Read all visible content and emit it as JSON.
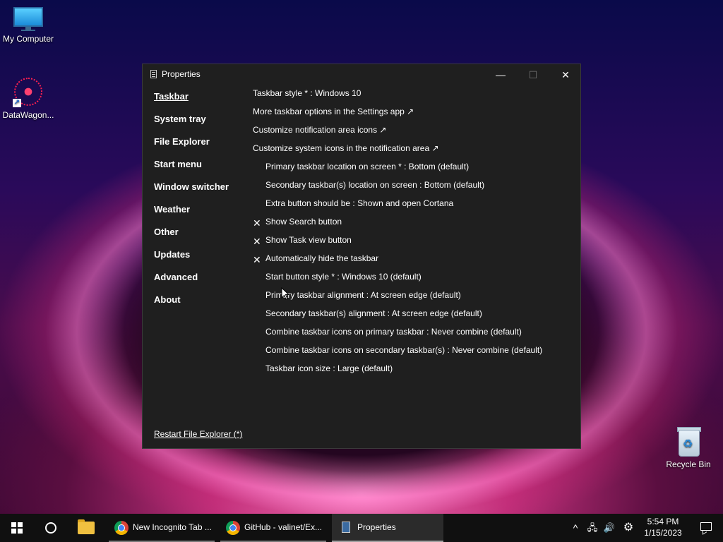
{
  "desktop": {
    "icons": [
      {
        "label": "My Computer"
      },
      {
        "label": "DataWagon..."
      },
      {
        "label": "Recycle Bin"
      }
    ]
  },
  "window": {
    "title": "Properties",
    "minimize_glyph": "—",
    "maximize_glyph": "☐",
    "close_glyph": "✕",
    "nav": [
      "Taskbar",
      "System tray",
      "File Explorer",
      "Start menu",
      "Window switcher",
      "Weather",
      "Other",
      "Updates",
      "Advanced",
      "About"
    ],
    "active_nav": "Taskbar",
    "settings": [
      {
        "text": "Taskbar style * : Windows 10",
        "indent": false,
        "checked": false
      },
      {
        "text": "More taskbar options in the Settings app ↗",
        "indent": false,
        "checked": false
      },
      {
        "text": "Customize notification area icons ↗",
        "indent": false,
        "checked": false
      },
      {
        "text": "Customize system icons in the notification area ↗",
        "indent": false,
        "checked": false
      },
      {
        "text": "Primary taskbar location on screen * : Bottom (default)",
        "indent": true,
        "checked": false
      },
      {
        "text": "Secondary taskbar(s) location on screen : Bottom (default)",
        "indent": true,
        "checked": false
      },
      {
        "text": "Extra button should be : Shown and open Cortana",
        "indent": true,
        "checked": false
      },
      {
        "text": "Show Search button",
        "indent": true,
        "checked": true
      },
      {
        "text": "Show Task view button",
        "indent": true,
        "checked": true
      },
      {
        "text": "Automatically hide the taskbar",
        "indent": true,
        "checked": true
      },
      {
        "text": "Start button style * : Windows 10 (default)",
        "indent": true,
        "checked": false
      },
      {
        "text": "Primary taskbar alignment : At screen edge (default)",
        "indent": true,
        "checked": false
      },
      {
        "text": "Secondary taskbar(s) alignment : At screen edge (default)",
        "indent": true,
        "checked": false
      },
      {
        "text": "Combine taskbar icons on primary taskbar : Never combine (default)",
        "indent": true,
        "checked": false
      },
      {
        "text": "Combine taskbar icons on secondary taskbar(s) : Never combine (default)",
        "indent": true,
        "checked": false
      },
      {
        "text": "Taskbar icon size : Large (default)",
        "indent": true,
        "checked": false
      }
    ],
    "check_glyph": "✕",
    "restart_link": "Restart File Explorer (*)"
  },
  "taskbar": {
    "tasks": [
      {
        "label": "New Incognito Tab ...",
        "icon": "chrome-icon"
      },
      {
        "label": "GitHub - valinet/Ex...",
        "icon": "chrome-icon"
      },
      {
        "label": "Properties",
        "icon": "properties-icon"
      }
    ],
    "tray_chevron": "^",
    "tray_network": "🖧",
    "tray_volume": "🔊",
    "tray_gear": "⚙",
    "time": "5:54 PM",
    "date": "1/15/2023"
  }
}
